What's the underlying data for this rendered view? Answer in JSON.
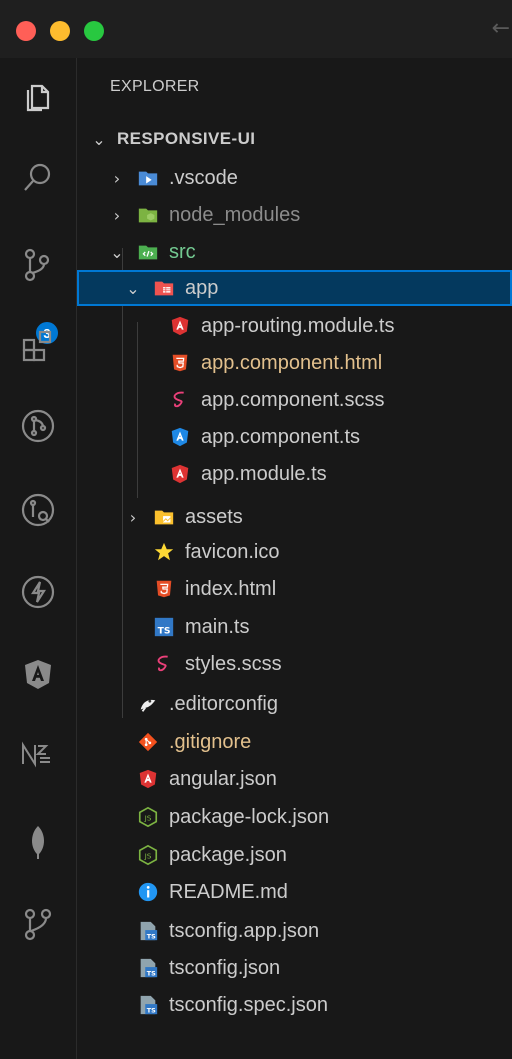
{
  "colors": {
    "accent": "#0078d4",
    "selection_bg": "#04395e",
    "modified": "#e2c08d",
    "untracked": "#73c991"
  },
  "window": {
    "back_arrow_icon": "arrow-left-icon"
  },
  "activity_bar": {
    "items": [
      {
        "icon": "files-icon"
      },
      {
        "icon": "search-icon"
      },
      {
        "icon": "source-control-icon",
        "badge": "3"
      },
      {
        "icon": "extensions-icon"
      },
      {
        "icon": "git-pull-request-icon"
      },
      {
        "icon": "git-compare-icon"
      },
      {
        "icon": "lightning-icon"
      },
      {
        "icon": "angular-icon"
      },
      {
        "icon": "nx-icon"
      },
      {
        "icon": "mongodb-leaf-icon"
      },
      {
        "icon": "source-control-graph-icon"
      }
    ]
  },
  "explorer": {
    "title": "EXPLORER",
    "project": "RESPONSIVE-UI",
    "tree": [
      {
        "label": ".vscode",
        "icon": "vscode-folder-icon",
        "chevron": "›",
        "status": "normal"
      },
      {
        "label": "node_modules",
        "icon": "node-folder-icon",
        "chevron": "›",
        "status": "ignored"
      },
      {
        "label": "src",
        "icon": "src-folder-icon",
        "chevron": "⌄",
        "status": "untracked"
      },
      {
        "label": "app",
        "icon": "app-folder-icon",
        "chevron": "⌄",
        "status": "normal"
      },
      {
        "label": "app-routing.module.ts",
        "icon": "angular-file-icon",
        "status": "normal"
      },
      {
        "label": "app.component.html",
        "icon": "html-file-icon",
        "status": "modified"
      },
      {
        "label": "app.component.scss",
        "icon": "sass-file-icon",
        "status": "normal"
      },
      {
        "label": "app.component.ts",
        "icon": "angular-component-icon",
        "status": "normal"
      },
      {
        "label": "app.module.ts",
        "icon": "angular-file-icon",
        "status": "normal"
      },
      {
        "label": "assets",
        "icon": "assets-folder-icon",
        "chevron": "›",
        "status": "normal"
      },
      {
        "label": "favicon.ico",
        "icon": "star-icon",
        "status": "normal"
      },
      {
        "label": "index.html",
        "icon": "html-file-icon",
        "status": "normal"
      },
      {
        "label": "main.ts",
        "icon": "typescript-file-icon",
        "status": "normal"
      },
      {
        "label": "styles.scss",
        "icon": "sass-file-icon",
        "status": "normal"
      },
      {
        "label": ".editorconfig",
        "icon": "editorconfig-icon",
        "status": "normal"
      },
      {
        "label": ".gitignore",
        "icon": "git-icon",
        "status": "modified"
      },
      {
        "label": "angular.json",
        "icon": "angular-file-icon",
        "status": "normal"
      },
      {
        "label": "package-lock.json",
        "icon": "nodejs-icon",
        "status": "normal"
      },
      {
        "label": "package.json",
        "icon": "nodejs-icon",
        "status": "normal"
      },
      {
        "label": "README.md",
        "icon": "info-icon",
        "status": "normal"
      },
      {
        "label": "tsconfig.app.json",
        "icon": "tsconfig-icon",
        "status": "normal"
      },
      {
        "label": "tsconfig.json",
        "icon": "tsconfig-icon",
        "status": "normal"
      },
      {
        "label": "tsconfig.spec.json",
        "icon": "tsconfig-icon",
        "status": "normal"
      }
    ]
  }
}
